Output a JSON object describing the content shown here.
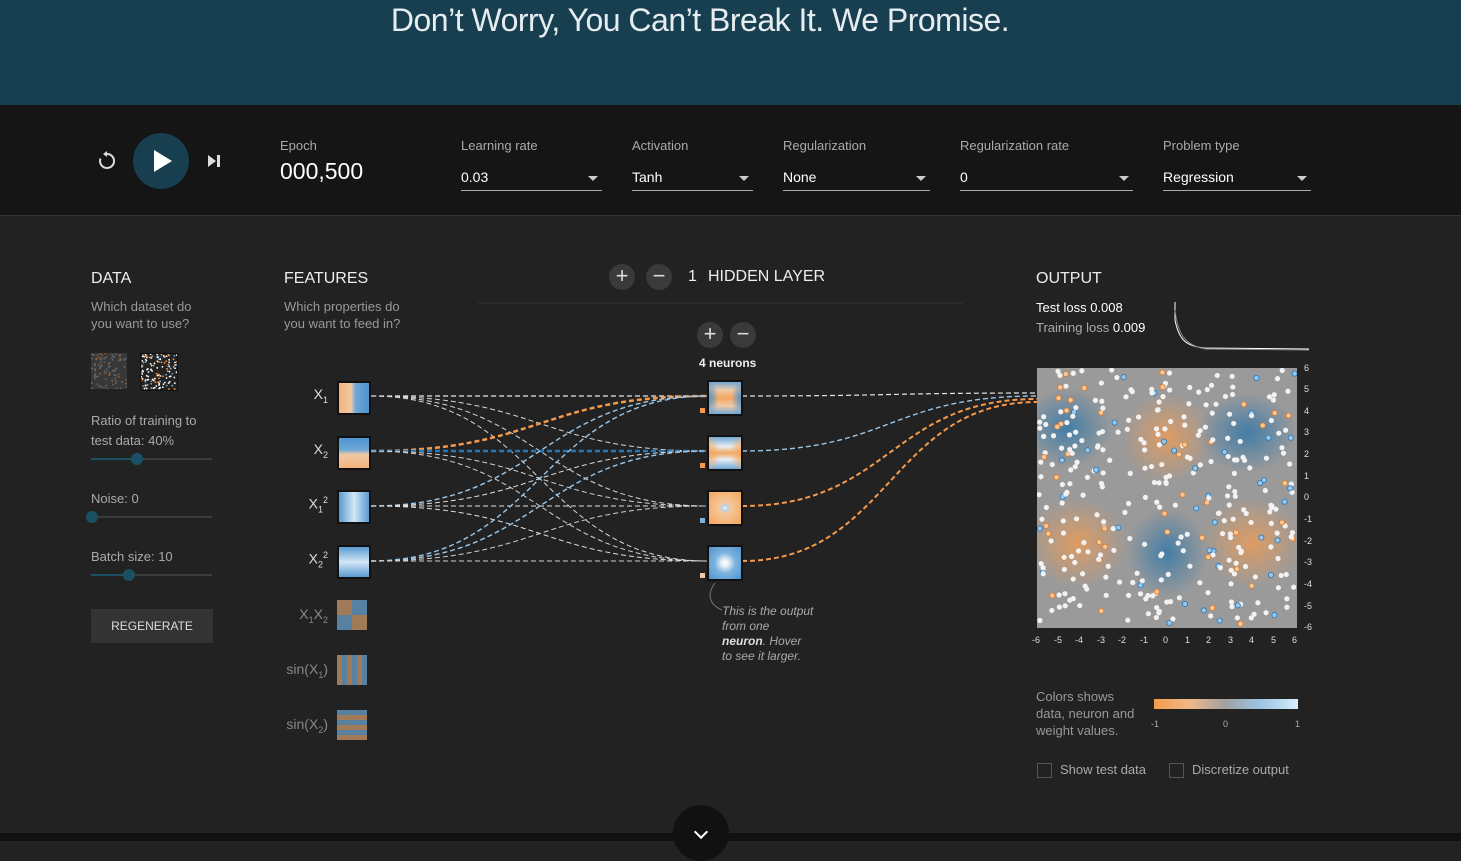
{
  "header": {
    "title": "Don’t Worry, You Can’t Break It. We Promise."
  },
  "controls": {
    "epoch_label": "Epoch",
    "epoch_value": "000,500",
    "learning_rate_label": "Learning rate",
    "learning_rate_value": "0.03",
    "activation_label": "Activation",
    "activation_value": "Tanh",
    "regularization_label": "Regularization",
    "regularization_value": "None",
    "regularization_rate_label": "Regularization rate",
    "regularization_rate_value": "0",
    "problem_type_label": "Problem type",
    "problem_type_value": "Regression"
  },
  "data_panel": {
    "title": "DATA",
    "question_line1": "Which dataset do",
    "question_line2": "you want to use?",
    "ratio_label_line1": "Ratio of training to",
    "ratio_label_line2": "test data:  40%",
    "ratio_value": 40,
    "noise_label": "Noise:  0",
    "noise_value": 0,
    "batch_label": "Batch size:  10",
    "batch_value": 10,
    "regenerate_label": "REGENERATE"
  },
  "features_panel": {
    "title": "FEATURES",
    "question_line1": "Which properties do",
    "question_line2": "you want to feed in?"
  },
  "network": {
    "hidden_layer_count": "1",
    "hidden_layer_label": "HIDDEN LAYER",
    "neurons_label": "4 neurons",
    "tooltip_line1": "This is the output",
    "tooltip_line2": "from one",
    "tooltip_bold": "neuron",
    "tooltip_line3": ". Hover",
    "tooltip_line4": "to see it larger."
  },
  "output_panel": {
    "title": "OUTPUT",
    "test_loss_label": "Test loss",
    "test_loss_value": "0.008",
    "training_loss_label": "Training loss",
    "training_loss_value": "0.009",
    "y_ticks": [
      "6",
      "5",
      "4",
      "3",
      "2",
      "1",
      "0",
      "-1",
      "-2",
      "-3",
      "-4",
      "-5",
      "-6"
    ],
    "x_ticks": [
      "-6",
      "-5",
      "-4",
      "-3",
      "-2",
      "-1",
      "0",
      "1",
      "2",
      "3",
      "4",
      "5",
      "6"
    ],
    "legend_line1": "Colors shows",
    "legend_line2": "data, neuron and",
    "legend_line3": "weight values.",
    "legend_min": "-1",
    "legend_mid": "0",
    "legend_max": "1",
    "show_test_label": "Show test data",
    "discretize_label": "Discretize output"
  },
  "colors": {
    "header_bg": "#183f50",
    "positive_blue": "#0877bd",
    "negative_orange": "#f59322"
  }
}
